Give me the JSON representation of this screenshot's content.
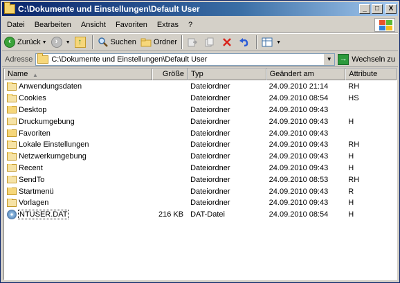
{
  "window": {
    "title": "C:\\Dokumente und Einstellungen\\Default User",
    "controls": {
      "minimize": "_",
      "maximize": "□",
      "close": "X"
    }
  },
  "menu": {
    "items": [
      {
        "label": "Datei"
      },
      {
        "label": "Bearbeiten"
      },
      {
        "label": "Ansicht"
      },
      {
        "label": "Favoriten"
      },
      {
        "label": "Extras"
      },
      {
        "label": "?"
      }
    ]
  },
  "toolbar": {
    "back_label": "Zurück",
    "search_label": "Suchen",
    "folders_label": "Ordner"
  },
  "address": {
    "label": "Adresse",
    "value": "C:\\Dokumente und Einstellungen\\Default User",
    "go_label": "Wechseln zu"
  },
  "columns": {
    "name": "Name",
    "size": "Größe",
    "type": "Typ",
    "modified": "Geändert am",
    "attributes": "Attribute"
  },
  "files": [
    {
      "name": "Anwendungsdaten",
      "size": "",
      "type": "Dateiordner",
      "modified": "24.09.2010 21:14",
      "attr": "RH",
      "icon": "folder-icon"
    },
    {
      "name": "Cookies",
      "size": "",
      "type": "Dateiordner",
      "modified": "24.09.2010 08:54",
      "attr": "HS",
      "icon": "folder-icon"
    },
    {
      "name": "Desktop",
      "size": "",
      "type": "Dateiordner",
      "modified": "24.09.2010 09:43",
      "attr": "",
      "icon": "folder-icon"
    },
    {
      "name": "Druckumgebung",
      "size": "",
      "type": "Dateiordner",
      "modified": "24.09.2010 09:43",
      "attr": "H",
      "icon": "folder-icon"
    },
    {
      "name": "Favoriten",
      "size": "",
      "type": "Dateiordner",
      "modified": "24.09.2010 09:43",
      "attr": "",
      "icon": "folder-icon"
    },
    {
      "name": "Lokale Einstellungen",
      "size": "",
      "type": "Dateiordner",
      "modified": "24.09.2010 09:43",
      "attr": "RH",
      "icon": "folder-icon"
    },
    {
      "name": "Netzwerkumgebung",
      "size": "",
      "type": "Dateiordner",
      "modified": "24.09.2010 09:43",
      "attr": "H",
      "icon": "folder-icon"
    },
    {
      "name": "Recent",
      "size": "",
      "type": "Dateiordner",
      "modified": "24.09.2010 09:43",
      "attr": "H",
      "icon": "folder-icon"
    },
    {
      "name": "SendTo",
      "size": "",
      "type": "Dateiordner",
      "modified": "24.09.2010 08:53",
      "attr": "RH",
      "icon": "folder-icon"
    },
    {
      "name": "Startmenü",
      "size": "",
      "type": "Dateiordner",
      "modified": "24.09.2010 09:43",
      "attr": "R",
      "icon": "folder-icon"
    },
    {
      "name": "Vorlagen",
      "size": "",
      "type": "Dateiordner",
      "modified": "24.09.2010 09:43",
      "attr": "H",
      "icon": "folder-icon"
    },
    {
      "name": "NTUSER.DAT",
      "size": "216 KB",
      "type": "DAT-Datei",
      "modified": "24.09.2010 08:54",
      "attr": "H",
      "icon": "dat-file-icon",
      "focused": true
    }
  ]
}
